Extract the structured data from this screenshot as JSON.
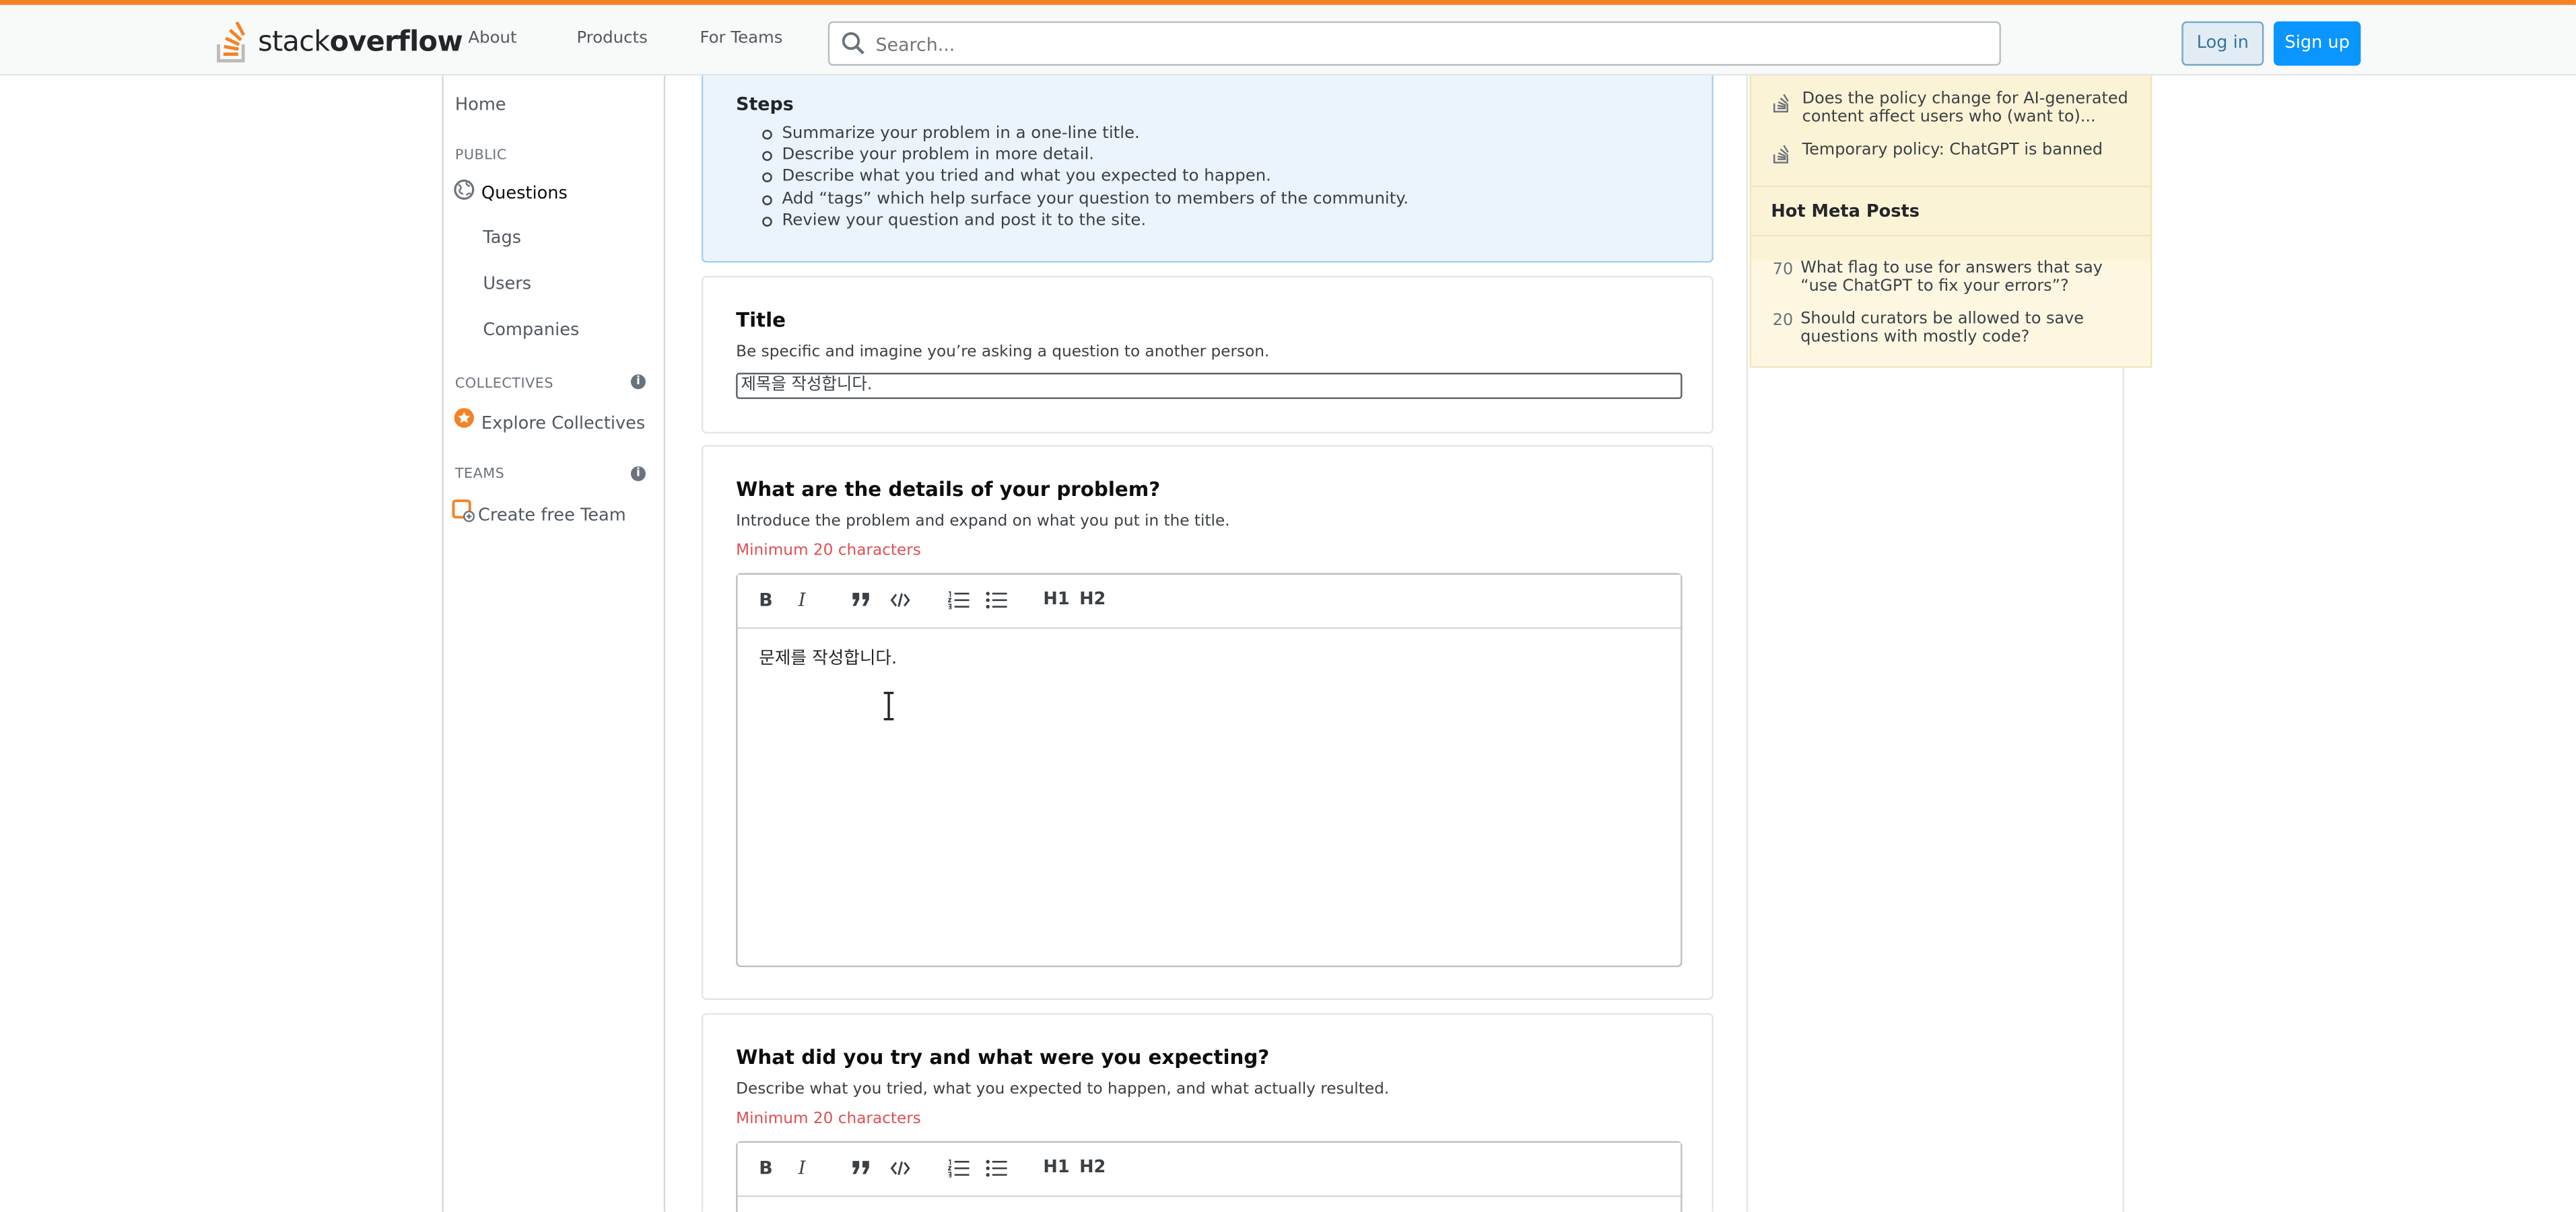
{
  "header": {
    "logo_stack": "stack",
    "logo_overflow": "overflow",
    "nav": [
      "About",
      "Products",
      "For Teams"
    ],
    "search_placeholder": "Search...",
    "login": "Log in",
    "signup": "Sign up"
  },
  "sidebar": {
    "home": "Home",
    "public_head": "PUBLIC",
    "questions": "Questions",
    "tags": "Tags",
    "users": "Users",
    "companies": "Companies",
    "collectives_head": "COLLECTIVES",
    "explore_collectives": "Explore Collectives",
    "teams_head": "TEAMS",
    "create_team": "Create free Team"
  },
  "steps": {
    "title": "Steps",
    "items": [
      "Summarize your problem in a one-line title.",
      "Describe your problem in more detail.",
      "Describe what you tried and what you expected to happen.",
      "Add “tags” which help surface your question to members of the community.",
      "Review your question and post it to the site."
    ]
  },
  "title_card": {
    "heading": "Title",
    "hint": "Be specific and imagine you’re asking a question to another person.",
    "value": "제목을 작성합니다."
  },
  "details_card": {
    "heading": "What are the details of your problem?",
    "hint": "Introduce the problem and expand on what you put in the title.",
    "error": "Minimum 20 characters",
    "body": "문제를 작성합니다."
  },
  "tried_card": {
    "heading": "What did you try and what were you expecting?",
    "hint": "Describe what you tried, what you expected to happen, and what actually resulted.",
    "error": "Minimum 20 characters"
  },
  "toolbar": {
    "bold": "B",
    "italic": "I",
    "h1": "H1",
    "h2": "H2"
  },
  "meta": {
    "featured": [
      "Does the policy change for AI-generated content affect users who (want to)...",
      "Temporary policy: ChatGPT is banned"
    ],
    "hot_head": "Hot Meta Posts",
    "hot": [
      {
        "score": "70",
        "text": "What flag to use for answers that say “use ChatGPT to fix your errors”?"
      },
      {
        "score": "20",
        "text": "Should curators be allowed to save questions with mostly code?"
      }
    ]
  },
  "colors": {
    "accent": "#f48225",
    "primary": "#0a95ff",
    "error": "#de4f54"
  }
}
